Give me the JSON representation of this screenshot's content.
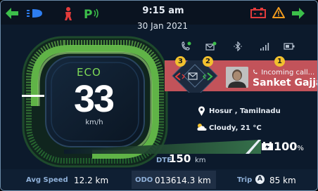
{
  "header": {
    "time": "9:15 am",
    "date": "30 Jan 2021",
    "icons": [
      "left-turn-arrow-icon",
      "headlight-icon",
      "side-stand-warning-icon",
      "parking-icon",
      "battery-warning-icon",
      "hazard-warning-icon",
      "right-turn-arrow-icon"
    ],
    "parking_label": "P"
  },
  "status_icons": [
    "phone-connected-icon",
    "message-icon",
    "bluetooth-icon",
    "signal-icon",
    "battery-small-icon"
  ],
  "dial": {
    "mode": "ECO",
    "speed": "33",
    "speed_unit": "km/h"
  },
  "call": {
    "status": "Incoming call...",
    "caller": "Sanket Gajjar",
    "badges": [
      "1",
      "2",
      "3"
    ]
  },
  "info": {
    "location": "Hosur , Tamilnadu",
    "weather": "Cloudy, 21 °C"
  },
  "battery": {
    "percent_value": "100",
    "percent_sign": "%",
    "level": 1.0
  },
  "dte": {
    "label": "DTE",
    "value": "150",
    "unit": "km"
  },
  "bottom": {
    "avg_speed_label": "Avg Speed",
    "avg_speed_value": "12.2 km",
    "odo_label": "ODO",
    "odo_value": "013614.3 km",
    "trip_label": "Trip",
    "trip_letter": "A",
    "trip_value": "85 km"
  },
  "colors": {
    "accent_green": "#7ed957",
    "call_panel": "#c2535a",
    "badge_yellow": "#f2c12e",
    "warning_red": "#e23b3b",
    "headlight_blue": "#2d7df0"
  }
}
